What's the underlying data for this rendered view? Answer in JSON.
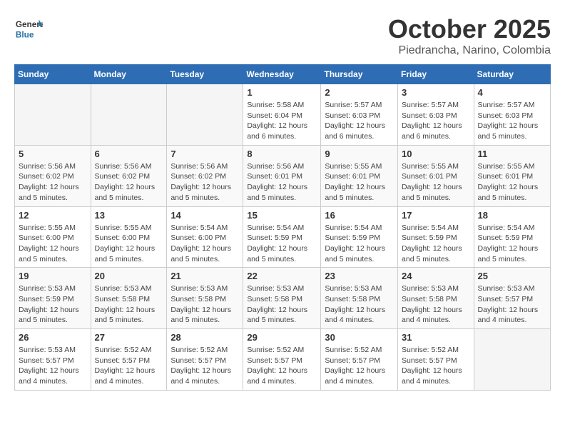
{
  "logo": {
    "text_general": "General",
    "text_blue": "Blue"
  },
  "title": "October 2025",
  "subtitle": "Piedrancha, Narino, Colombia",
  "weekdays": [
    "Sunday",
    "Monday",
    "Tuesday",
    "Wednesday",
    "Thursday",
    "Friday",
    "Saturday"
  ],
  "weeks": [
    [
      {
        "day": "",
        "info": ""
      },
      {
        "day": "",
        "info": ""
      },
      {
        "day": "",
        "info": ""
      },
      {
        "day": "1",
        "info": "Sunrise: 5:58 AM\nSunset: 6:04 PM\nDaylight: 12 hours and 6 minutes."
      },
      {
        "day": "2",
        "info": "Sunrise: 5:57 AM\nSunset: 6:03 PM\nDaylight: 12 hours and 6 minutes."
      },
      {
        "day": "3",
        "info": "Sunrise: 5:57 AM\nSunset: 6:03 PM\nDaylight: 12 hours and 6 minutes."
      },
      {
        "day": "4",
        "info": "Sunrise: 5:57 AM\nSunset: 6:03 PM\nDaylight: 12 hours and 5 minutes."
      }
    ],
    [
      {
        "day": "5",
        "info": "Sunrise: 5:56 AM\nSunset: 6:02 PM\nDaylight: 12 hours and 5 minutes."
      },
      {
        "day": "6",
        "info": "Sunrise: 5:56 AM\nSunset: 6:02 PM\nDaylight: 12 hours and 5 minutes."
      },
      {
        "day": "7",
        "info": "Sunrise: 5:56 AM\nSunset: 6:02 PM\nDaylight: 12 hours and 5 minutes."
      },
      {
        "day": "8",
        "info": "Sunrise: 5:56 AM\nSunset: 6:01 PM\nDaylight: 12 hours and 5 minutes."
      },
      {
        "day": "9",
        "info": "Sunrise: 5:55 AM\nSunset: 6:01 PM\nDaylight: 12 hours and 5 minutes."
      },
      {
        "day": "10",
        "info": "Sunrise: 5:55 AM\nSunset: 6:01 PM\nDaylight: 12 hours and 5 minutes."
      },
      {
        "day": "11",
        "info": "Sunrise: 5:55 AM\nSunset: 6:01 PM\nDaylight: 12 hours and 5 minutes."
      }
    ],
    [
      {
        "day": "12",
        "info": "Sunrise: 5:55 AM\nSunset: 6:00 PM\nDaylight: 12 hours and 5 minutes."
      },
      {
        "day": "13",
        "info": "Sunrise: 5:55 AM\nSunset: 6:00 PM\nDaylight: 12 hours and 5 minutes."
      },
      {
        "day": "14",
        "info": "Sunrise: 5:54 AM\nSunset: 6:00 PM\nDaylight: 12 hours and 5 minutes."
      },
      {
        "day": "15",
        "info": "Sunrise: 5:54 AM\nSunset: 5:59 PM\nDaylight: 12 hours and 5 minutes."
      },
      {
        "day": "16",
        "info": "Sunrise: 5:54 AM\nSunset: 5:59 PM\nDaylight: 12 hours and 5 minutes."
      },
      {
        "day": "17",
        "info": "Sunrise: 5:54 AM\nSunset: 5:59 PM\nDaylight: 12 hours and 5 minutes."
      },
      {
        "day": "18",
        "info": "Sunrise: 5:54 AM\nSunset: 5:59 PM\nDaylight: 12 hours and 5 minutes."
      }
    ],
    [
      {
        "day": "19",
        "info": "Sunrise: 5:53 AM\nSunset: 5:59 PM\nDaylight: 12 hours and 5 minutes."
      },
      {
        "day": "20",
        "info": "Sunrise: 5:53 AM\nSunset: 5:58 PM\nDaylight: 12 hours and 5 minutes."
      },
      {
        "day": "21",
        "info": "Sunrise: 5:53 AM\nSunset: 5:58 PM\nDaylight: 12 hours and 5 minutes."
      },
      {
        "day": "22",
        "info": "Sunrise: 5:53 AM\nSunset: 5:58 PM\nDaylight: 12 hours and 5 minutes."
      },
      {
        "day": "23",
        "info": "Sunrise: 5:53 AM\nSunset: 5:58 PM\nDaylight: 12 hours and 4 minutes."
      },
      {
        "day": "24",
        "info": "Sunrise: 5:53 AM\nSunset: 5:58 PM\nDaylight: 12 hours and 4 minutes."
      },
      {
        "day": "25",
        "info": "Sunrise: 5:53 AM\nSunset: 5:57 PM\nDaylight: 12 hours and 4 minutes."
      }
    ],
    [
      {
        "day": "26",
        "info": "Sunrise: 5:53 AM\nSunset: 5:57 PM\nDaylight: 12 hours and 4 minutes."
      },
      {
        "day": "27",
        "info": "Sunrise: 5:52 AM\nSunset: 5:57 PM\nDaylight: 12 hours and 4 minutes."
      },
      {
        "day": "28",
        "info": "Sunrise: 5:52 AM\nSunset: 5:57 PM\nDaylight: 12 hours and 4 minutes."
      },
      {
        "day": "29",
        "info": "Sunrise: 5:52 AM\nSunset: 5:57 PM\nDaylight: 12 hours and 4 minutes."
      },
      {
        "day": "30",
        "info": "Sunrise: 5:52 AM\nSunset: 5:57 PM\nDaylight: 12 hours and 4 minutes."
      },
      {
        "day": "31",
        "info": "Sunrise: 5:52 AM\nSunset: 5:57 PM\nDaylight: 12 hours and 4 minutes."
      },
      {
        "day": "",
        "info": ""
      }
    ]
  ]
}
